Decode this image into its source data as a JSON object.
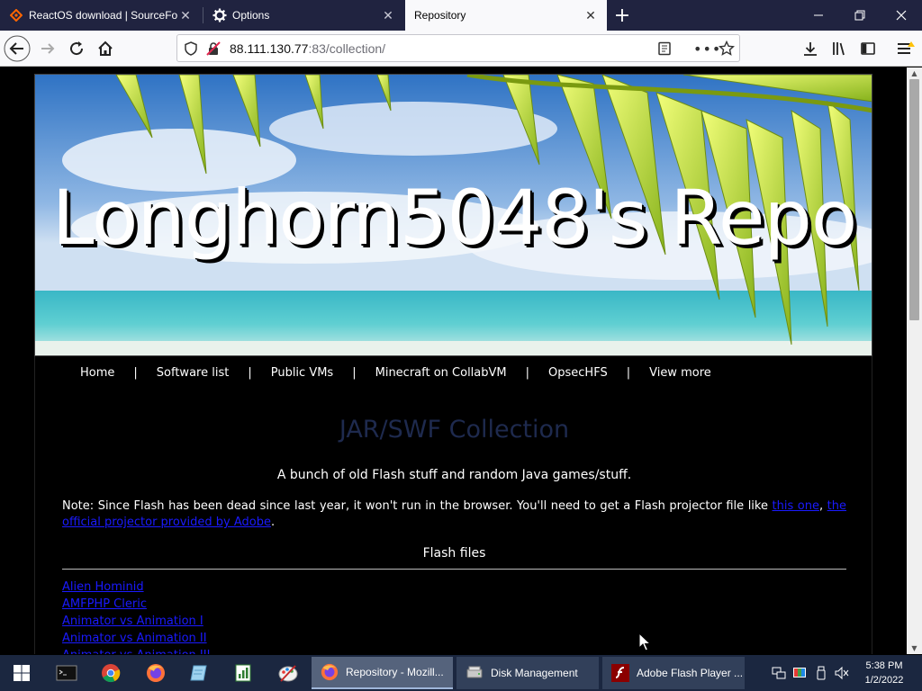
{
  "browser": {
    "tabs": [
      {
        "label": "ReactOS download | SourceFor",
        "icon": "sourceforge-icon",
        "active": false
      },
      {
        "label": "Options",
        "icon": "gear-icon",
        "active": false
      },
      {
        "label": "Repository",
        "icon": "",
        "active": true
      }
    ],
    "new_tab_symbol": "+",
    "close_symbol": "✕",
    "url": {
      "host": "88.111.130.77",
      "rest": ":83/collection/"
    }
  },
  "page": {
    "banner_title": "Longhorn5048's Repo",
    "menu": [
      "Home",
      "Software list",
      "Public VMs",
      "Minecraft on CollabVM",
      "OpsecHFS",
      "View more"
    ],
    "menu_separator": "|",
    "heading": "JAR/SWF Collection",
    "subtitle": "A bunch of old Flash stuff and random Java games/stuff.",
    "note_text": "Note: Since Flash has been dead since last year, it won't run in the browser. You'll need to get a Flash projector file like ",
    "note_link1": "this one",
    "note_comma": ", ",
    "note_link2": "the official projector provided by Adobe",
    "note_end": ".",
    "flash_heading": "Flash files",
    "flash_files": [
      "Alien Hominid",
      "AMFPHP Cleric",
      "Animator vs Animation I",
      "Animator vs Animation II",
      "Animator vs Animation III"
    ]
  },
  "taskbar": {
    "tasks": [
      {
        "label": "Repository - Mozill...",
        "icon": "firefox-icon",
        "active": true
      },
      {
        "label": "Disk Management",
        "icon": "disk-management-icon",
        "active": false
      },
      {
        "label": "Adobe Flash Player ...",
        "icon": "flash-icon",
        "active": false
      }
    ],
    "time": "5:38 PM",
    "date": "1/2/2022"
  },
  "colors": {
    "tabstrip": "#202340",
    "heading": "#1e2a4e",
    "link": "#1a1aff",
    "taskbar": "#1b2740"
  }
}
